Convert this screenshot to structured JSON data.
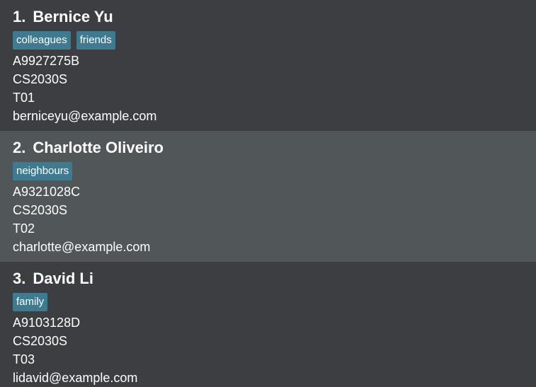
{
  "persons": [
    {
      "index": "1.",
      "name": "Bernice Yu",
      "tags": [
        "colleagues",
        "friends"
      ],
      "student_id": "A9927275B",
      "module": "CS2030S",
      "tutorial": "T01",
      "email": "berniceyu@example.com"
    },
    {
      "index": "2.",
      "name": "Charlotte Oliveiro",
      "tags": [
        "neighbours"
      ],
      "student_id": "A9321028C",
      "module": "CS2030S",
      "tutorial": "T02",
      "email": "charlotte@example.com"
    },
    {
      "index": "3.",
      "name": "David Li",
      "tags": [
        "family"
      ],
      "student_id": "A9103128D",
      "module": "CS2030S",
      "tutorial": "T03",
      "email": "lidavid@example.com"
    }
  ],
  "colors": {
    "card_odd_bg": "#3c3e41",
    "card_even_bg": "#515658",
    "tag_bg": "#3e7b91",
    "text": "#ffffff"
  }
}
